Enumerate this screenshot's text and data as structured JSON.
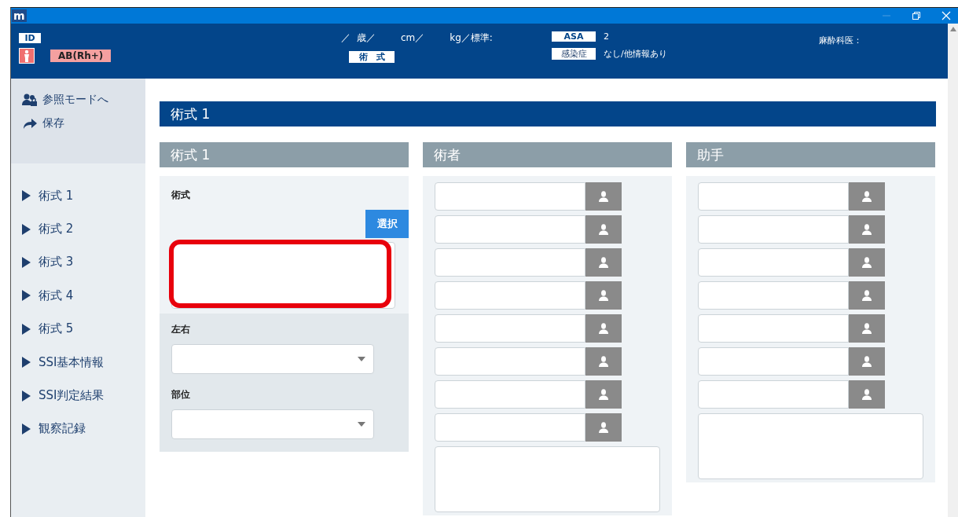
{
  "window": {
    "app_icon": "m"
  },
  "header": {
    "id_label": "ID",
    "blood_type": "AB(Rh+)",
    "age_sep": "／",
    "age_unit": "歳／",
    "height_unit": "cm／",
    "weight_unit": "kg／標準:",
    "procedure_label": "術　式",
    "asa_label": "ASA",
    "asa_value": "2",
    "infection_label": "感染症",
    "infection_value": "なし/他情報あり",
    "anesthesiologist_label": "麻酔科医："
  },
  "sidebar": {
    "actions": [
      {
        "label": "参照モードへ",
        "kind": "reference"
      },
      {
        "label": "保存",
        "kind": "save"
      }
    ],
    "items": [
      {
        "label": "術式 1"
      },
      {
        "label": "術式 2"
      },
      {
        "label": "術式 3"
      },
      {
        "label": "術式 4"
      },
      {
        "label": "術式 5"
      },
      {
        "label": "SSI基本情報"
      },
      {
        "label": "SSI判定結果"
      },
      {
        "label": "観察記録"
      }
    ]
  },
  "main": {
    "title": "術式 1",
    "procedure_panel": {
      "title": "術式 1",
      "procedure_label": "術式",
      "select_button": "選択",
      "highlighted": true,
      "side_label": "左右",
      "site_label": "部位"
    },
    "surgeons": {
      "title": "術者",
      "rows": [
        {
          "kind": "person"
        },
        {
          "kind": "person"
        },
        {
          "kind": "person"
        },
        {
          "kind": "person"
        },
        {
          "kind": "person"
        },
        {
          "kind": "person"
        },
        {
          "kind": "person"
        },
        {
          "kind": "person"
        }
      ]
    },
    "assistants": {
      "title": "助手",
      "rows": [
        {
          "kind": "person"
        },
        {
          "kind": "person"
        },
        {
          "kind": "person"
        },
        {
          "kind": "person"
        },
        {
          "kind": "person"
        },
        {
          "kind": "person"
        },
        {
          "kind": "person"
        }
      ]
    }
  }
}
